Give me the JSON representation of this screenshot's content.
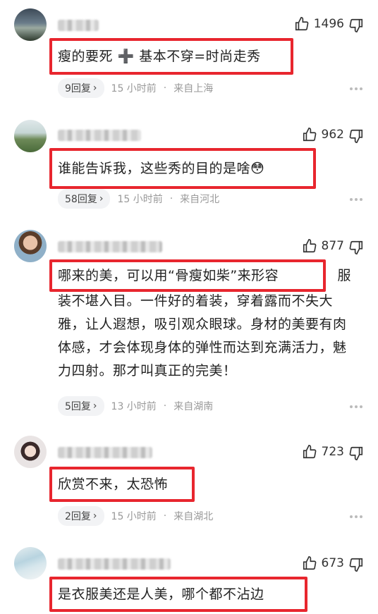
{
  "comments": [
    {
      "likes": "1496",
      "text": "瘦的要死 ➕ 基本不穿=时尚走秀",
      "reply_label": "9回复",
      "time": "15 小时前",
      "location": "来自上海"
    },
    {
      "likes": "962",
      "text": "谁能告诉我，这些秀的目的是啥😳",
      "reply_label": "58回复",
      "time": "15 小时前",
      "location": "来自河北"
    },
    {
      "likes": "877",
      "text_highlight": "哪来的美，可以用“骨瘦如柴”来形容",
      "text_rest_line1": "服",
      "text_rest": "装不堪入目。一件好的着装，穿着露而不失大雅，让人遐想，吸引观众眼球。身材的美要有肉体感，才会体现身体的弹性而达到充满活力，魅力四射。那才叫真正的完美！",
      "reply_label": "5回复",
      "time": "13 小时前",
      "location": "来自湖南"
    },
    {
      "likes": "723",
      "text": "欣赏不来，太恐怖",
      "reply_label": "2回复",
      "time": "15 小时前",
      "location": "来自湖北"
    },
    {
      "likes": "673",
      "text": "是衣服美还是人美，哪个都不沾边"
    }
  ],
  "meta_separator": "·",
  "chevron": "›",
  "colors": {
    "highlight_border": "#e8262e",
    "meta_text": "#999999"
  },
  "icons": {
    "like": "thumb-up-icon",
    "dislike": "thumb-down-icon",
    "more": "more-dots-icon"
  }
}
